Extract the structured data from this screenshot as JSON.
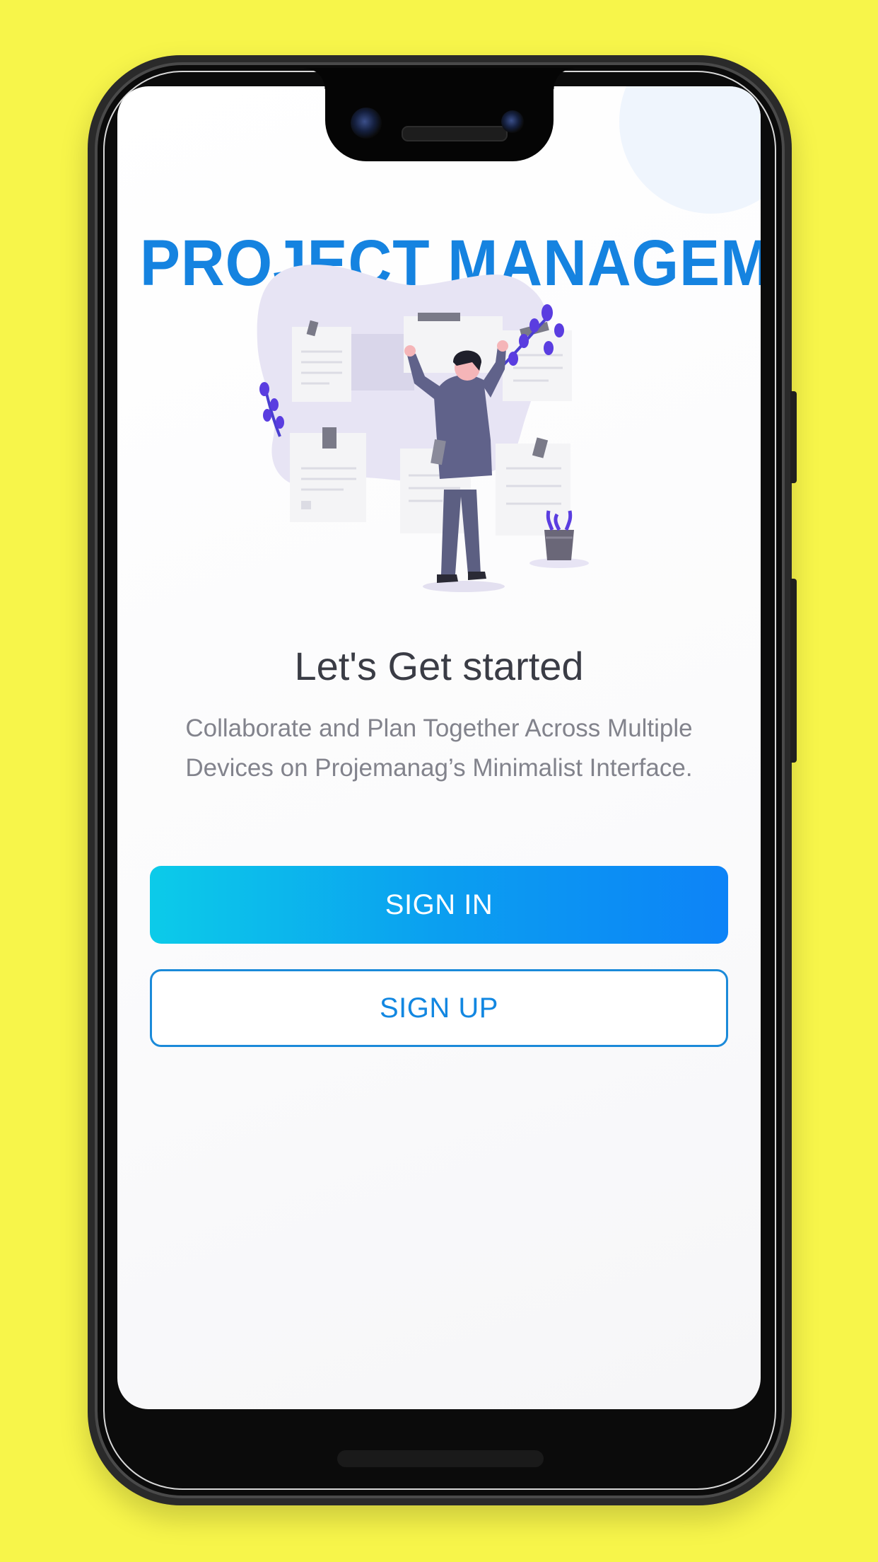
{
  "app": {
    "title": "PROJECT MANAGEMENT"
  },
  "onboarding": {
    "heading": "Let's Get started",
    "description": "Collaborate and Plan Together Across Multiple Devices on Projemanag’s Minimalist Interface."
  },
  "actions": {
    "sign_in_label": "SIGN IN",
    "sign_up_label": "SIGN UP"
  },
  "icons": {
    "illustration": "person-pinning-notes-illustration"
  },
  "colors": {
    "background": "#f7f54a",
    "title": "#1583e0",
    "sign_in_gradient_start": "#0ccbe9",
    "sign_in_gradient_end": "#0d83f7",
    "sign_up_border": "#1b8ad9",
    "illustration_accent": "#5a3de0"
  }
}
